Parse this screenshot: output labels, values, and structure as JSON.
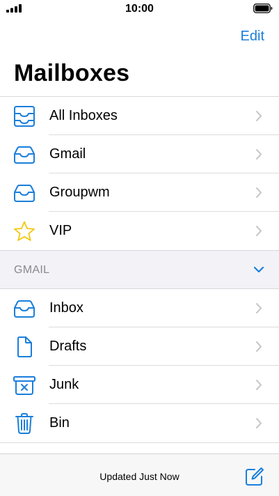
{
  "status_bar": {
    "time": "10:00",
    "signal_icon": "cellular-signal-icon",
    "battery_icon": "battery-icon"
  },
  "nav": {
    "edit_label": "Edit"
  },
  "page": {
    "title": "Mailboxes"
  },
  "mailboxes": [
    {
      "label": "All Inboxes",
      "icon": "all-inboxes-icon"
    },
    {
      "label": "Gmail",
      "icon": "inbox-tray-icon"
    },
    {
      "label": "Groupwm",
      "icon": "inbox-tray-icon"
    },
    {
      "label": "VIP",
      "icon": "star-icon"
    }
  ],
  "gmail_section": {
    "title": "GMAIL",
    "expanded": true,
    "items": [
      {
        "label": "Inbox",
        "icon": "inbox-tray-icon"
      },
      {
        "label": "Drafts",
        "icon": "document-icon"
      },
      {
        "label": "Junk",
        "icon": "junk-bin-icon"
      },
      {
        "label": "Bin",
        "icon": "trash-icon"
      }
    ]
  },
  "toolbar": {
    "status": "Updated Just Now",
    "compose_icon": "compose-icon"
  },
  "colors": {
    "accent": "#1a7fdb",
    "star": "#f2c811",
    "group_bg": "#f2f2f7",
    "toolbar_bg": "#f7f7f8"
  }
}
